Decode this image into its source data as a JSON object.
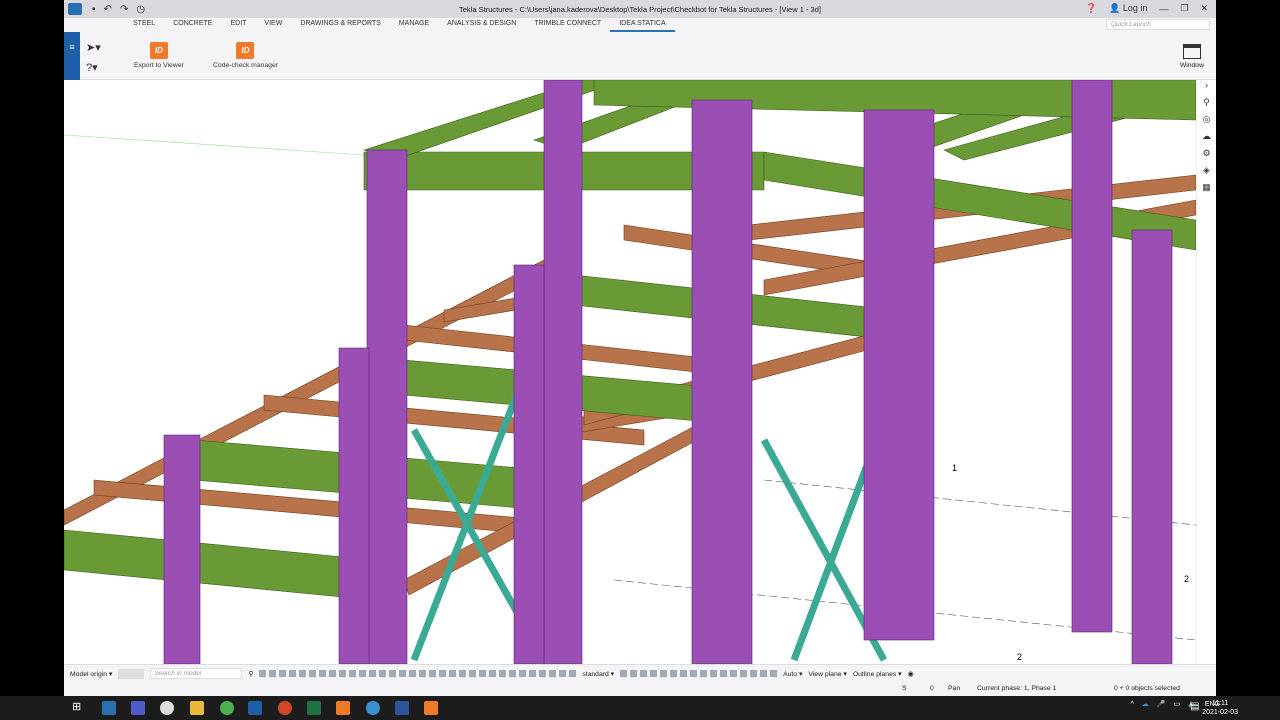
{
  "window": {
    "title": "Tekla Structures - C:\\Users\\jana.kaderova\\Desktop\\Tekla Project\\Checkbot for Tekla Structures - [View 1 - 3d]",
    "login": "Log in"
  },
  "tabs": [
    "STEEL",
    "CONCRETE",
    "EDIT",
    "VIEW",
    "DRAWINGS & REPORTS",
    "MANAGE",
    "ANALYSIS & DESIGN",
    "TRIMBLE CONNECT",
    "IDEA STATICA"
  ],
  "active_tab": "IDEA STATICA",
  "quick_launch": {
    "placeholder": "Quick Launch"
  },
  "ribbon": {
    "export": "Export to Viewer",
    "codecheck": "Code-check manager",
    "window": "Window",
    "icon_text": "ID"
  },
  "viewport": {
    "grid_labels": [
      "1",
      "2",
      "2"
    ]
  },
  "bottom_toolbar": {
    "origin": "Model origin ▾",
    "search_placeholder": "Search in model",
    "standard": "standard ▾",
    "auto": "Auto ▾",
    "view_plane": "View plane ▾",
    "outline_planes": "Outline planes ▾"
  },
  "status": {
    "s": "S",
    "zero": "0",
    "mode": "Pan",
    "phase": "Current phase: 1, Phase 1",
    "selected": "0 + 0 objects selected"
  },
  "taskbar": {
    "lang": "ENG",
    "time": "11:11",
    "date": "2021-02-03"
  },
  "colors": {
    "column": "#9b4fb5",
    "beam_green": "#6a9a35",
    "beam_brown": "#b8734a",
    "brace": "#3aaa95",
    "accent": "#1f5fa8",
    "idea": "#f07a28"
  }
}
